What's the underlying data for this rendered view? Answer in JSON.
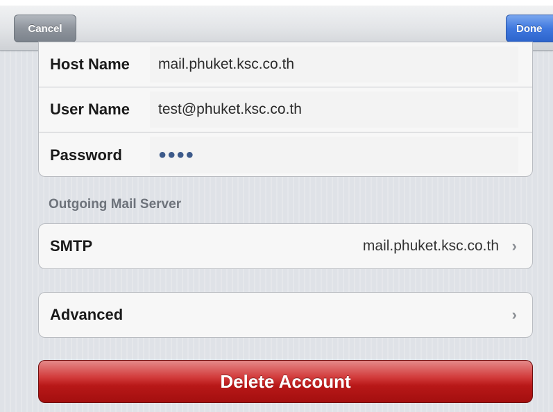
{
  "navbar": {
    "cancel_label": "Cancel",
    "done_label": "Done"
  },
  "incoming": {
    "rows": [
      {
        "label": "Host Name",
        "value": "mail.phuket.ksc.co.th"
      },
      {
        "label": "User Name",
        "value": "test@phuket.ksc.co.th"
      },
      {
        "label": "Password",
        "value": "●●●●"
      }
    ]
  },
  "outgoing": {
    "header": "Outgoing Mail Server",
    "smtp_label": "SMTP",
    "smtp_value": "mail.phuket.ksc.co.th"
  },
  "advanced": {
    "label": "Advanced"
  },
  "delete": {
    "label": "Delete Account"
  },
  "icons": {
    "chevron": "›"
  },
  "colors": {
    "done_blue": "#3f78df",
    "delete_red": "#b81818"
  }
}
